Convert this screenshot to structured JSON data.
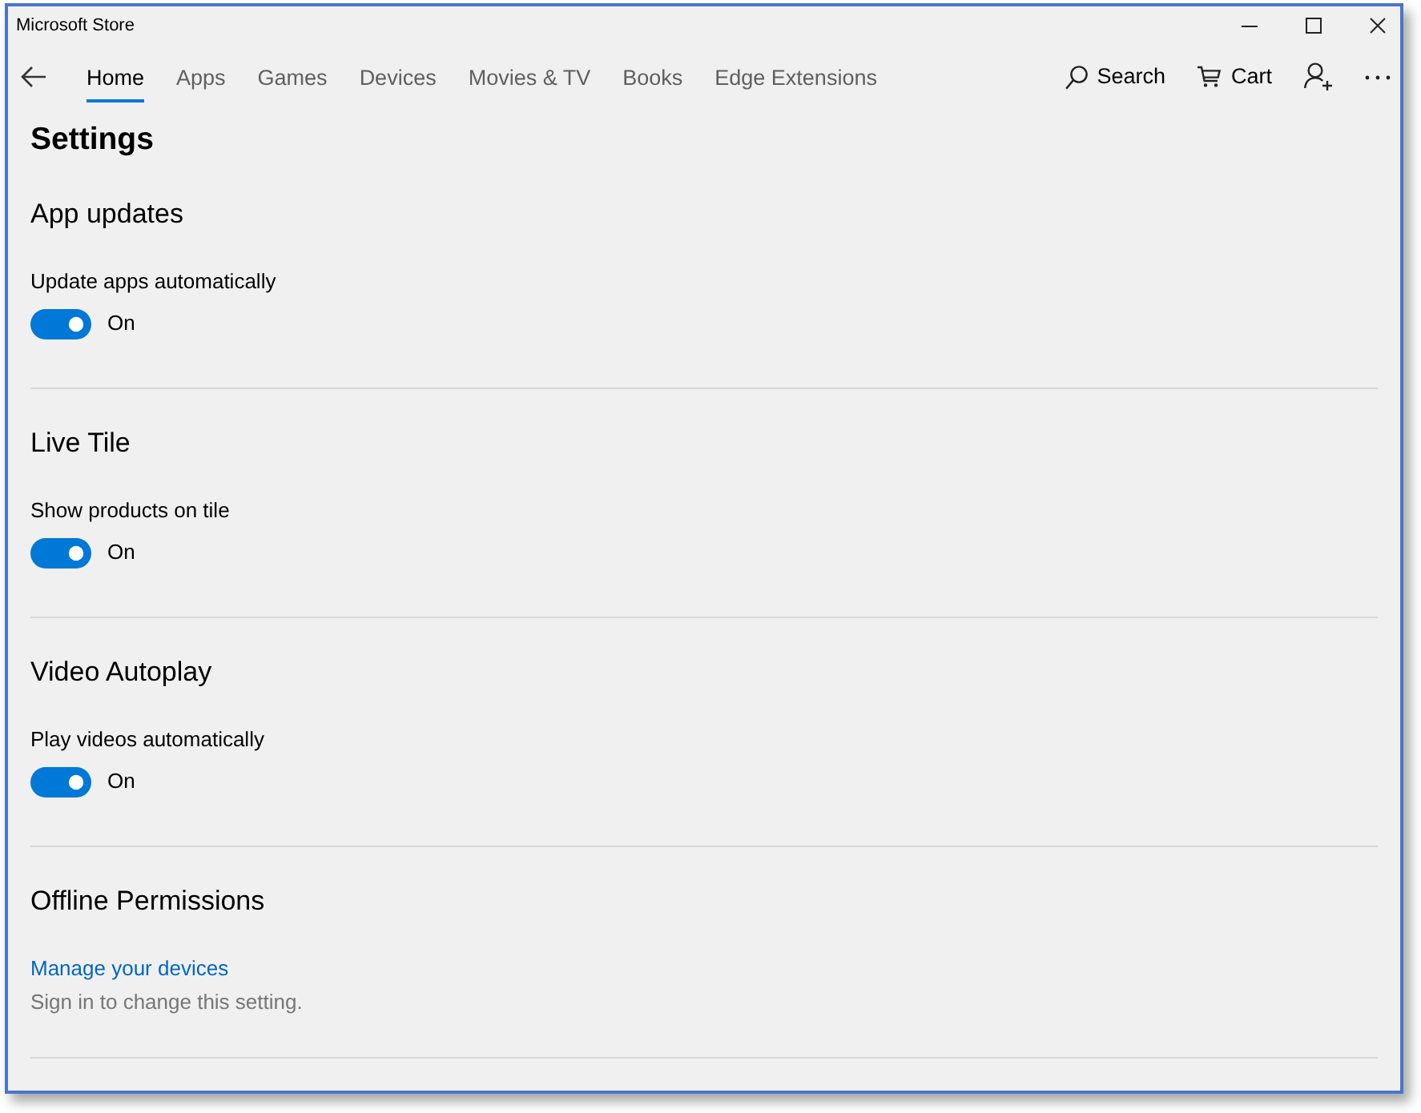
{
  "window": {
    "title": "Microsoft Store"
  },
  "nav": {
    "tabs": [
      {
        "label": "Home",
        "selected": true
      },
      {
        "label": "Apps",
        "selected": false
      },
      {
        "label": "Games",
        "selected": false
      },
      {
        "label": "Devices",
        "selected": false
      },
      {
        "label": "Movies & TV",
        "selected": false
      },
      {
        "label": "Books",
        "selected": false
      },
      {
        "label": "Edge Extensions",
        "selected": false
      }
    ],
    "actions": [
      {
        "kind": "search",
        "label": "Search"
      },
      {
        "kind": "cart",
        "label": "Cart"
      }
    ]
  },
  "page": {
    "title": "Settings",
    "sections": [
      {
        "kind": "toggle",
        "heading": "App updates",
        "label": "Update apps automatically",
        "on": true,
        "state_text": "On"
      },
      {
        "kind": "toggle",
        "heading": "Live Tile",
        "label": "Show products on tile",
        "on": true,
        "state_text": "On"
      },
      {
        "kind": "toggle",
        "heading": "Video Autoplay",
        "label": "Play videos automatically",
        "on": true,
        "state_text": "On"
      },
      {
        "kind": "link",
        "heading": "Offline Permissions",
        "link": "Manage your devices",
        "note": "Sign in to change this setting."
      }
    ]
  }
}
